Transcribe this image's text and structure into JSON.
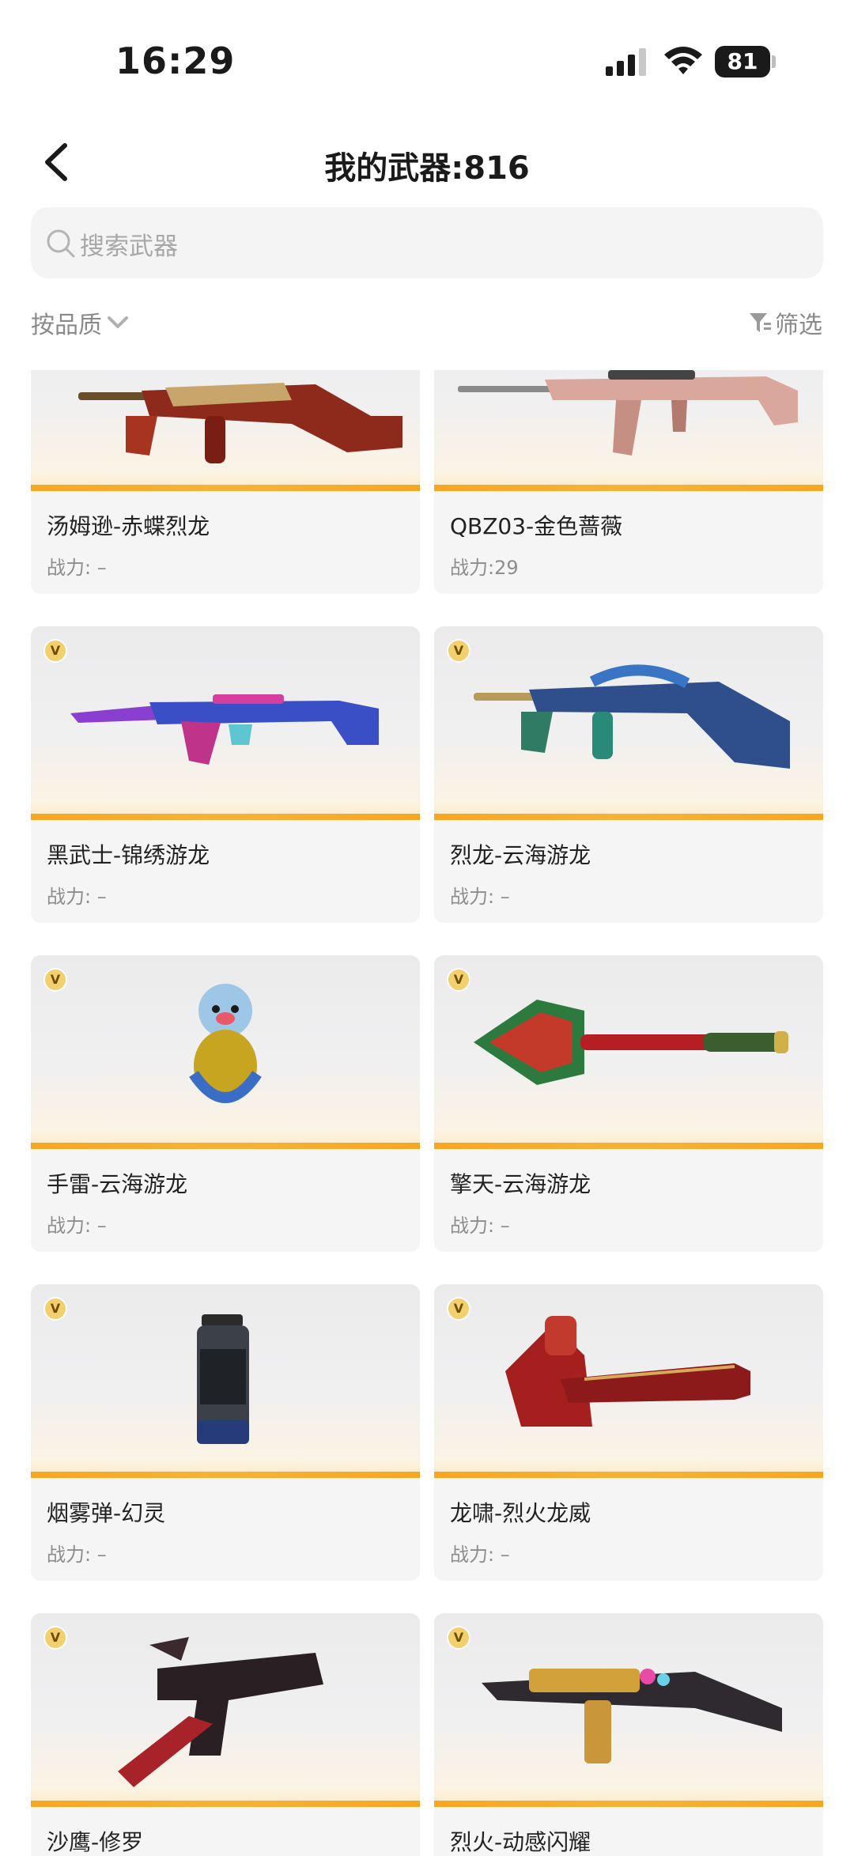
{
  "status": {
    "time": "16:29",
    "battery": "81"
  },
  "nav": {
    "title": "我的武器:816"
  },
  "search": {
    "placeholder": "搜索武器"
  },
  "sort": {
    "label": "按品质",
    "filter_label": "筛选"
  },
  "badge_letter": "V",
  "accent": "#f5a623",
  "weapons": [
    {
      "name": "汤姆逊-赤蝶烈龙",
      "power": "战力: –",
      "vip": false
    },
    {
      "name": "QBZ03-金色蔷薇",
      "power": "战力:29",
      "vip": false
    },
    {
      "name": "黑武士-锦绣游龙",
      "power": "战力: –",
      "vip": true
    },
    {
      "name": "烈龙-云海游龙",
      "power": "战力: –",
      "vip": true
    },
    {
      "name": "手雷-云海游龙",
      "power": "战力: –",
      "vip": true
    },
    {
      "name": "擎天-云海游龙",
      "power": "战力: –",
      "vip": true
    },
    {
      "name": "烟雾弹-幻灵",
      "power": "战力: –",
      "vip": true
    },
    {
      "name": "龙啸-烈火龙威",
      "power": "战力: –",
      "vip": true
    },
    {
      "name": "沙鹰-修罗",
      "power": "",
      "vip": true
    },
    {
      "name": "烈火-动感闪耀",
      "power": "",
      "vip": true
    }
  ]
}
